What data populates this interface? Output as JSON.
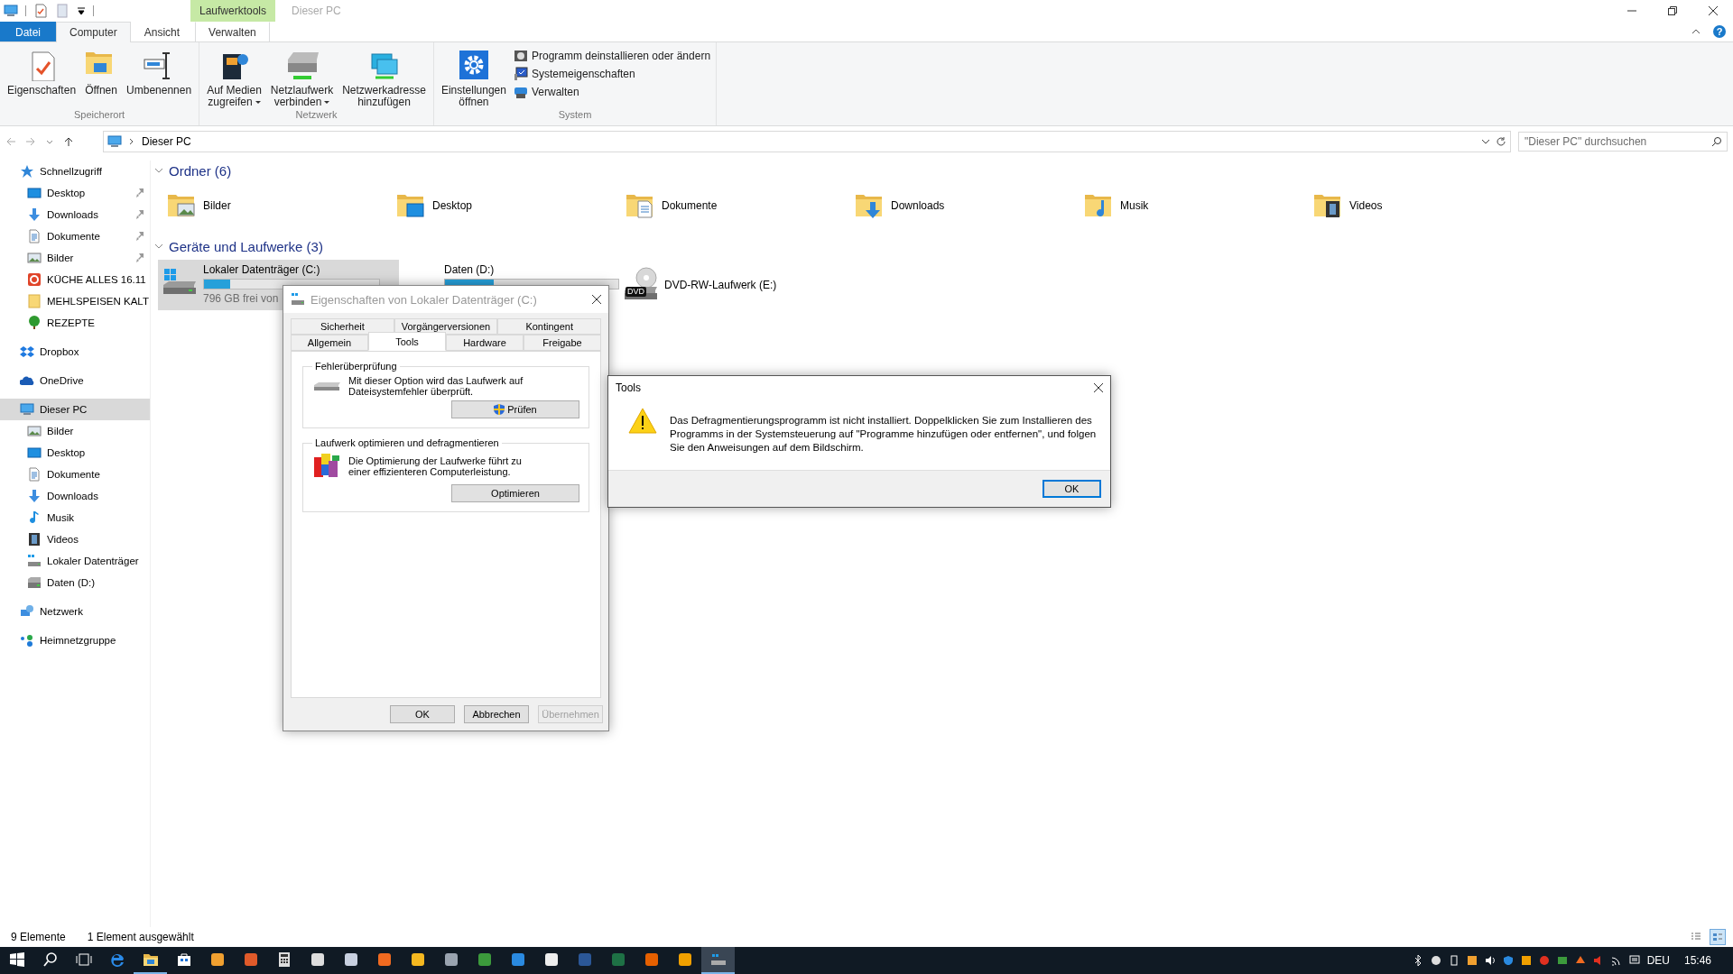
{
  "window": {
    "context_group": "Laufwerktools",
    "title": "Dieser PC"
  },
  "ribbon": {
    "tabs": [
      {
        "label": "Datei",
        "kind": "file",
        "selected": false
      },
      {
        "label": "Computer",
        "kind": "tab",
        "selected": true
      },
      {
        "label": "Ansicht",
        "kind": "tab",
        "selected": false
      },
      {
        "label": "Verwalten",
        "kind": "context",
        "selected": false
      }
    ],
    "help": "?",
    "groups": [
      {
        "label": "Speicherort",
        "commands": [
          {
            "kind": "large",
            "lines": [
              "Eigenschaften"
            ],
            "dropdown": false
          },
          {
            "kind": "large",
            "lines": [
              "Öffnen"
            ],
            "dropdown": false
          },
          {
            "kind": "large",
            "lines": [
              "Umbenennen"
            ],
            "dropdown": false
          }
        ]
      },
      {
        "label": "Netzwerk",
        "commands": [
          {
            "kind": "large",
            "lines": [
              "Auf Medien",
              "zugreifen"
            ],
            "dropdown": true
          },
          {
            "kind": "large",
            "lines": [
              "Netzlaufwerk",
              "verbinden"
            ],
            "dropdown": true
          },
          {
            "kind": "large",
            "lines": [
              "Netzwerkadresse",
              "hinzufügen"
            ],
            "dropdown": false
          }
        ]
      },
      {
        "label": "System",
        "commands": [
          {
            "kind": "large",
            "lines": [
              "Einstellungen",
              "öffnen"
            ],
            "dropdown": false
          },
          {
            "kind": "small",
            "lines": [
              "Programm deinstallieren oder ändern"
            ],
            "dropdown": false
          },
          {
            "kind": "small",
            "lines": [
              "Systemeigenschaften"
            ],
            "dropdown": false
          },
          {
            "kind": "small",
            "lines": [
              "Verwalten"
            ],
            "dropdown": false
          }
        ]
      }
    ]
  },
  "address": {
    "path": "Dieser PC",
    "search_placeholder": "\"Dieser PC\" durchsuchen"
  },
  "sidebar": {
    "items": [
      {
        "label": "Schnellzugriff",
        "kind": "star",
        "selected": false,
        "children": [
          {
            "label": "Desktop",
            "kind": "desktop",
            "selected": false,
            "pinned": true
          },
          {
            "label": "Downloads",
            "kind": "downloads",
            "selected": false,
            "pinned": true
          },
          {
            "label": "Dokumente",
            "kind": "documents",
            "selected": false,
            "pinned": true
          },
          {
            "label": "Bilder",
            "kind": "pictures",
            "selected": false,
            "pinned": true
          },
          {
            "label": "KÜCHE ALLES 16.11",
            "kind": "app",
            "selected": false,
            "pinned": false
          },
          {
            "label": "MEHLSPEISEN KALT",
            "kind": "folder",
            "selected": false,
            "pinned": false
          },
          {
            "label": "REZEPTE",
            "kind": "tree",
            "selected": false,
            "pinned": false
          }
        ]
      },
      {
        "label": "Dropbox",
        "kind": "dropbox",
        "selected": false
      },
      {
        "label": "OneDrive",
        "kind": "onedrive",
        "selected": false
      },
      {
        "label": "Dieser PC",
        "kind": "pc",
        "selected": true,
        "children": [
          {
            "label": "Bilder",
            "kind": "pictures",
            "selected": false
          },
          {
            "label": "Desktop",
            "kind": "desktop",
            "selected": false
          },
          {
            "label": "Dokumente",
            "kind": "documents",
            "selected": false
          },
          {
            "label": "Downloads",
            "kind": "downloads",
            "selected": false
          },
          {
            "label": "Musik",
            "kind": "music",
            "selected": false
          },
          {
            "label": "Videos",
            "kind": "videos",
            "selected": false
          },
          {
            "label": "Lokaler Datenträger",
            "kind": "sysdrive",
            "selected": false
          },
          {
            "label": "Daten (D:)",
            "kind": "drive",
            "selected": false
          }
        ]
      },
      {
        "label": "Netzwerk",
        "kind": "network",
        "selected": false
      },
      {
        "label": "Heimnetzgruppe",
        "kind": "homegroup",
        "selected": false
      }
    ]
  },
  "sections": [
    {
      "title": "Ordner (6)",
      "expanded": true,
      "kind": "folders",
      "items": [
        {
          "name": "Bilder",
          "kind": "pictures"
        },
        {
          "name": "Desktop",
          "kind": "desktop"
        },
        {
          "name": "Dokumente",
          "kind": "documents"
        },
        {
          "name": "Downloads",
          "kind": "downloads"
        },
        {
          "name": "Musik",
          "kind": "music"
        },
        {
          "name": "Videos",
          "kind": "videos"
        }
      ]
    },
    {
      "title": "Geräte und Laufwerke (3)",
      "expanded": true,
      "kind": "drives",
      "items": [
        {
          "name": "Lokaler Datenträger (C:)",
          "kind": "sysdrive",
          "selected": true,
          "level": 0.15,
          "free": "796 GB frei von"
        },
        {
          "name": "Daten (D:)",
          "kind": "drive",
          "selected": false,
          "level": 0.28
        },
        {
          "name": "DVD-RW-Laufwerk (E:)",
          "kind": "dvd",
          "selected": false,
          "badge": "DVD"
        }
      ]
    }
  ],
  "status_bar": {
    "count": "9 Elemente",
    "selection": "1 Element ausgewählt",
    "views": [
      {
        "kind": "details",
        "selected": false
      },
      {
        "kind": "tiles",
        "selected": true
      }
    ]
  },
  "properties_dialog": {
    "title": "Eigenschaften von Lokaler Datenträger (C:)",
    "active": false,
    "tab_rows": [
      [
        {
          "label": "Sicherheit",
          "selected": false
        },
        {
          "label": "Vorgängerversionen",
          "selected": false
        },
        {
          "label": "Kontingent",
          "selected": false
        }
      ],
      [
        {
          "label": "Allgemein",
          "selected": false
        },
        {
          "label": "Tools",
          "selected": true
        },
        {
          "label": "Hardware",
          "selected": false
        },
        {
          "label": "Freigabe",
          "selected": false
        }
      ]
    ],
    "groups": [
      {
        "title": "Fehlerüberprüfung",
        "kind": "check",
        "text": "Mit dieser Option wird das Laufwerk auf Dateisystemfehler überprüft.",
        "button": "Prüfen",
        "shield": true
      },
      {
        "title": "Laufwerk optimieren und defragmentieren",
        "kind": "defrag",
        "text": "Die Optimierung der Laufwerke führt zu einer effizienteren Computerleistung.",
        "button": "Optimieren",
        "shield": false
      }
    ],
    "buttons": [
      {
        "label": "OK",
        "disabled": false
      },
      {
        "label": "Abbrechen",
        "disabled": false
      },
      {
        "label": "Übernehmen",
        "disabled": true
      }
    ]
  },
  "message_box": {
    "title": "Tools",
    "active": true,
    "kind": "warning",
    "message": "Das Defragmentierungsprogramm ist nicht installiert. Doppelklicken Sie zum Installieren des Programms in der Systemsteuerung auf \"Programme hinzufügen oder entfernen\", und folgen Sie den Anweisungen auf dem Bildschirm.",
    "buttons": [
      {
        "label": "OK",
        "focused": true
      }
    ]
  },
  "taskbar": {
    "apps": [
      {
        "kind": "search",
        "open": false,
        "selected": false
      },
      {
        "kind": "taskview",
        "open": false,
        "selected": false
      },
      {
        "kind": "browser",
        "open": false,
        "selected": false
      },
      {
        "kind": "folder",
        "open": true,
        "selected": false
      },
      {
        "kind": "store",
        "open": false,
        "selected": false
      },
      {
        "kind": "app",
        "color": "#f0a030",
        "open": false,
        "selected": false
      },
      {
        "kind": "app",
        "color": "#e05a2a",
        "open": false,
        "selected": false
      },
      {
        "kind": "calc",
        "open": false,
        "selected": false
      },
      {
        "kind": "app",
        "color": "#dddddd",
        "open": false,
        "selected": false
      },
      {
        "kind": "app",
        "color": "#c8d0e0",
        "open": false,
        "selected": false
      },
      {
        "kind": "app",
        "color": "#f06a20",
        "open": false,
        "selected": false
      },
      {
        "kind": "app",
        "color": "#f5b820",
        "open": false,
        "selected": false
      },
      {
        "kind": "app",
        "color": "#9aa4b0",
        "open": false,
        "selected": false
      },
      {
        "kind": "app",
        "color": "#3c9a3c",
        "open": false,
        "selected": false
      },
      {
        "kind": "app",
        "color": "#2a8ae0",
        "open": false,
        "selected": false
      },
      {
        "kind": "app",
        "color": "#eeeeee",
        "open": false,
        "selected": false
      },
      {
        "kind": "app",
        "color": "#2b5797",
        "open": false,
        "selected": false
      },
      {
        "kind": "app",
        "color": "#1e7145",
        "open": false,
        "selected": false
      },
      {
        "kind": "app",
        "color": "#e66000",
        "open": false,
        "selected": false
      },
      {
        "kind": "app",
        "color": "#f0a000",
        "open": false,
        "selected": false
      },
      {
        "kind": "drive",
        "open": true,
        "selected": true
      }
    ],
    "language": "DEU",
    "time": "15:46"
  }
}
